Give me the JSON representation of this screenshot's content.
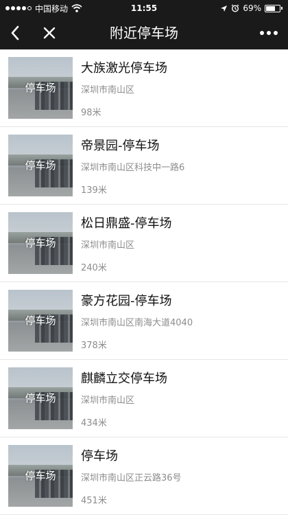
{
  "status_bar": {
    "carrier": "中国移动",
    "time": "11:55",
    "battery": "69%",
    "battery_level": 0.69
  },
  "nav": {
    "title": "附近停车场"
  },
  "thumb_label": "停车场",
  "items": [
    {
      "name": "大族激光停车场",
      "address": "深圳市南山区",
      "distance": "98米"
    },
    {
      "name": "帝景园-停车场",
      "address": "深圳市南山区科技中一路6",
      "distance": "139米"
    },
    {
      "name": "松日鼎盛-停车场",
      "address": "深圳市南山区",
      "distance": "240米"
    },
    {
      "name": "豪方花园-停车场",
      "address": "深圳市南山区南海大道4040",
      "distance": "378米"
    },
    {
      "name": "麒麟立交停车场",
      "address": "深圳市南山区",
      "distance": "434米"
    },
    {
      "name": "停车场",
      "address": "深圳市南山区正云路36号",
      "distance": "451米"
    }
  ]
}
